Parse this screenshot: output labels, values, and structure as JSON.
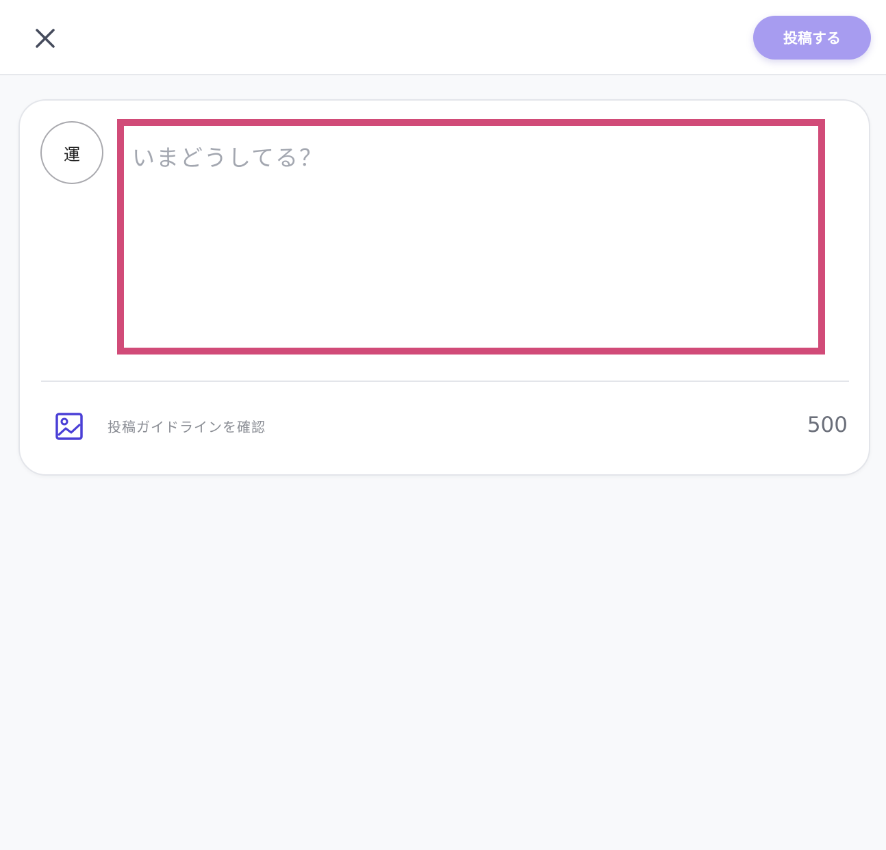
{
  "header": {
    "close_icon": "close-icon",
    "post_button_label": "投稿する",
    "post_button_color": "#a79cf0"
  },
  "composer": {
    "avatar_text": "運",
    "placeholder": "いまどうしてる？",
    "value": "",
    "highlight_color": "#d14b78"
  },
  "footer": {
    "image_icon": "image-icon",
    "guideline_label": "投稿ガイドラインを確認",
    "char_count": "500",
    "accent_color": "#4a3fd6"
  }
}
